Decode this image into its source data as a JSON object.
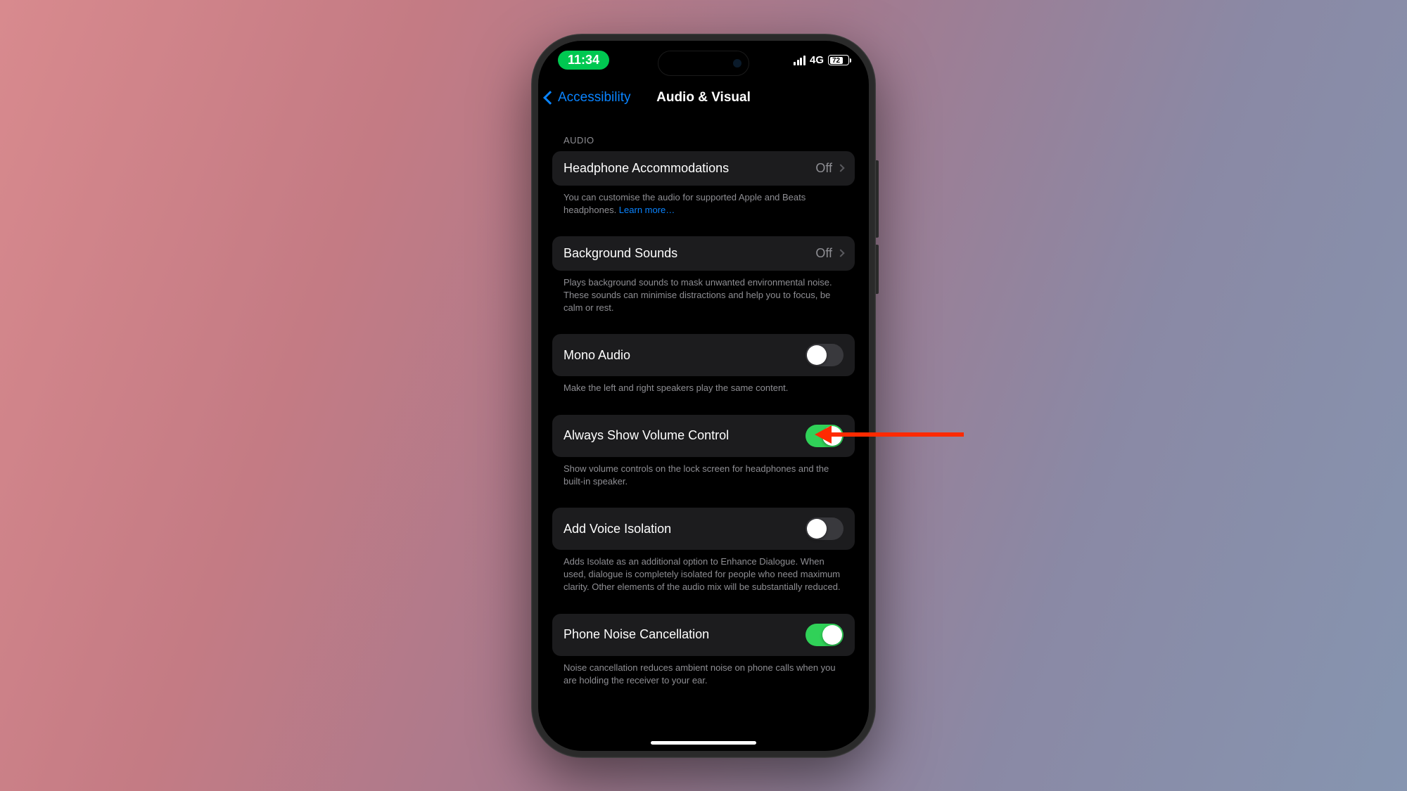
{
  "statusBar": {
    "time": "11:34",
    "network": "4G",
    "batteryPercent": "72"
  },
  "nav": {
    "back": "Accessibility",
    "title": "Audio & Visual"
  },
  "sections": {
    "audioHeader": "AUDIO",
    "headphone": {
      "label": "Headphone Accommodations",
      "value": "Off",
      "footer": "You can customise the audio for supported Apple and Beats headphones. ",
      "learnMore": "Learn more…"
    },
    "background": {
      "label": "Background Sounds",
      "value": "Off",
      "footer": "Plays background sounds to mask unwanted environmental noise. These sounds can minimise distractions and help you to focus, be calm or rest."
    },
    "mono": {
      "label": "Mono Audio",
      "footer": "Make the left and right speakers play the same content."
    },
    "volume": {
      "label": "Always Show Volume Control",
      "footer": "Show volume controls on the lock screen for headphones and the built-in speaker."
    },
    "voice": {
      "label": "Add Voice Isolation",
      "footer": "Adds Isolate as an additional option to Enhance Dialogue. When used, dialogue is completely isolated for people who need maximum clarity. Other elements of the audio mix will be substantially reduced."
    },
    "noise": {
      "label": "Phone Noise Cancellation",
      "footer": "Noise cancellation reduces ambient noise on phone calls when you are holding the receiver to your ear."
    }
  },
  "toggles": {
    "mono": false,
    "volume": true,
    "voice": false,
    "noise": true
  }
}
